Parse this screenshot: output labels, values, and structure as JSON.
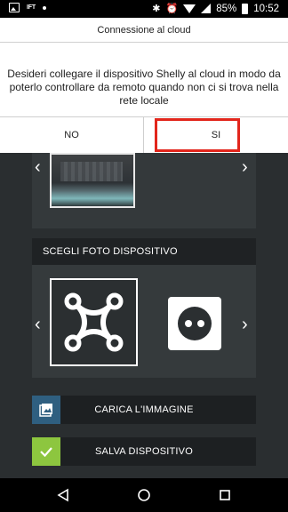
{
  "status_bar": {
    "icons_left": [
      "image-icon",
      "ift-icon",
      "dot-icon"
    ],
    "icons_right": [
      "bluetooth-icon",
      "alarm-icon",
      "wifi-icon",
      "signal-icon",
      "battery-icon"
    ],
    "ift_text": "IFT",
    "battery_percent": "85%",
    "time": "10:52"
  },
  "dialog": {
    "title": "Connessione al cloud",
    "message": "Desideri collegare il dispositivo Shelly al cloud in modo da poterlo controllare da remoto quando non ci si trova nella rete locale",
    "no_label": "NO",
    "yes_label": "SI"
  },
  "app": {
    "device_photo_section_title": "SCEGLI FOTO DISPOSITIVO",
    "upload_image_label": "CARICA L'IMMAGINE",
    "save_device_label": "SALVA DISPOSITIVO",
    "device_icons": [
      "shelly-node-icon",
      "power-socket-icon"
    ]
  },
  "colors": {
    "highlight": "#e2261c",
    "save_accent": "#8dc63f",
    "upload_accent": "#2f5f80"
  }
}
